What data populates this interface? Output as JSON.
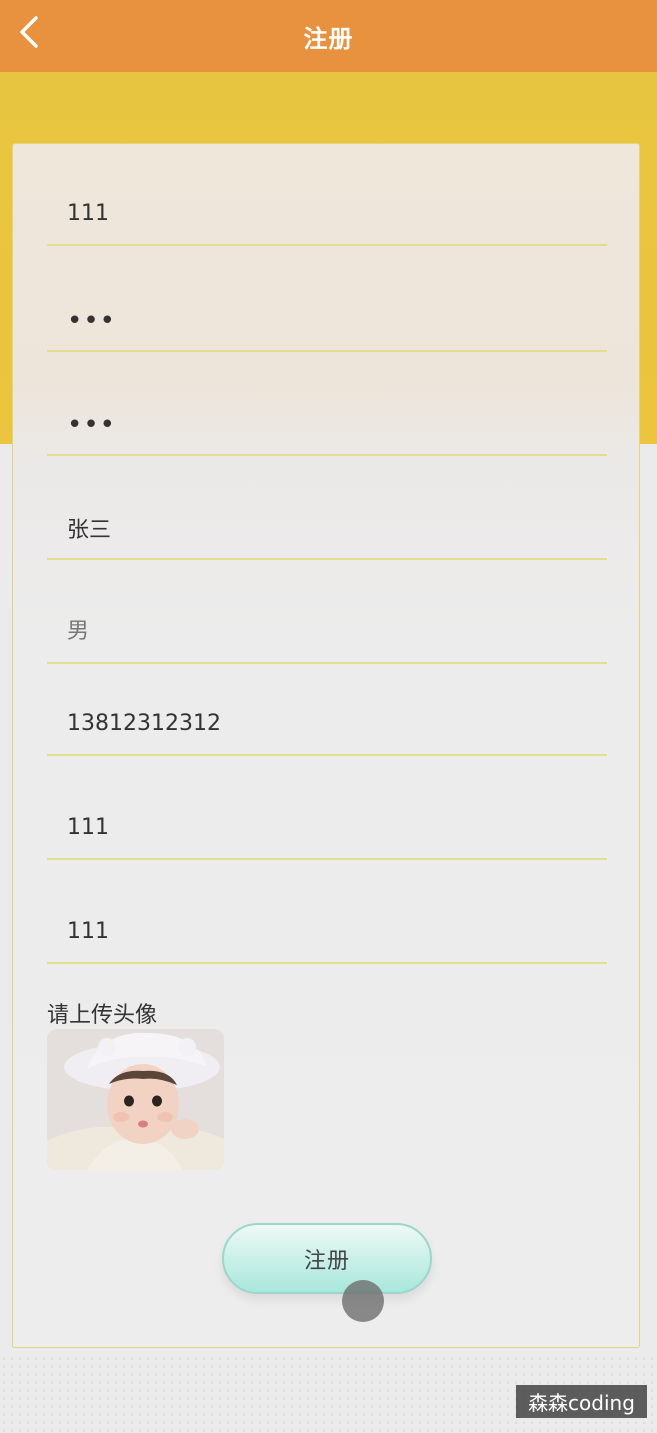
{
  "header": {
    "title": "注册",
    "back_icon": "chevron-left-icon"
  },
  "colors": {
    "header_bg": "#e8913f",
    "hero_bg": "#ecc43e",
    "field_underline": "#e2de8e",
    "button_bg": "#bdeee4"
  },
  "form": {
    "fields": [
      {
        "value": "111",
        "type": "text"
      },
      {
        "value": "123",
        "type": "password"
      },
      {
        "value": "123",
        "type": "password"
      },
      {
        "value": "张三",
        "type": "text"
      },
      {
        "value": "",
        "placeholder": "男",
        "type": "text"
      },
      {
        "value": "13812312312",
        "type": "tel"
      },
      {
        "value": "111",
        "type": "text"
      },
      {
        "value": "111",
        "type": "text"
      }
    ],
    "upload_label": "请上传头像",
    "submit_label": "注册"
  },
  "watermark": "森森coding"
}
